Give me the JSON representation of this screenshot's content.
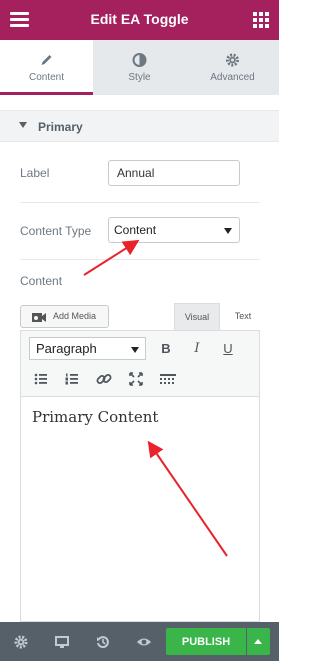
{
  "header": {
    "title": "Edit EA Toggle"
  },
  "tabs": [
    {
      "label": "Content",
      "icon": "pencil-icon",
      "active": true
    },
    {
      "label": "Style",
      "icon": "contrast-icon",
      "active": false
    },
    {
      "label": "Advanced",
      "icon": "gear-icon",
      "active": false
    }
  ],
  "section": {
    "title": "Primary"
  },
  "fields": {
    "label": {
      "label": "Label",
      "value": "Annual"
    },
    "content_type": {
      "label": "Content Type",
      "value": "Content"
    },
    "content": {
      "label": "Content"
    }
  },
  "editor": {
    "add_media": "Add Media",
    "tab_visual": "Visual",
    "tab_text": "Text",
    "format": "Paragraph",
    "bold": "B",
    "italic": "I",
    "underline": "U",
    "body": "Primary Content"
  },
  "footer": {
    "publish": "PUBLISH"
  },
  "colors": {
    "brand": "#a4215d",
    "publish": "#39b54a",
    "footer": "#556068",
    "annotation": "#e8232a"
  }
}
